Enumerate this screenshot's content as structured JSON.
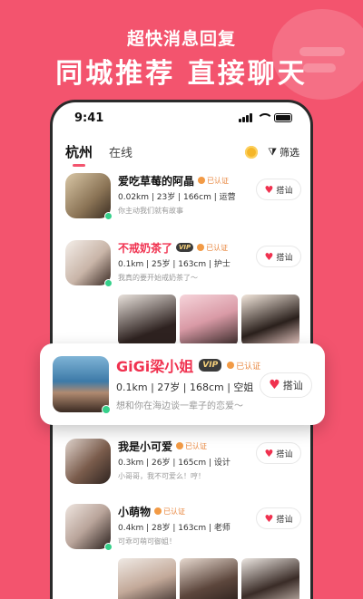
{
  "hero": {
    "subtitle": "超快消息回复",
    "title": "同城推荐 直接聊天"
  },
  "status_bar": {
    "time": "9:41"
  },
  "tabs": [
    {
      "label": "杭州",
      "active": true
    },
    {
      "label": "在线",
      "active": false
    }
  ],
  "filter": {
    "label": "筛选",
    "icon": "filter-icon"
  },
  "colors": {
    "brand": "#f3546e",
    "name_red": "#f0314f",
    "online": "#35d08a",
    "verified": "#e8853c"
  },
  "verified_label": "已认证",
  "vip_label": "VIP",
  "chat_label": "搭讪",
  "users": [
    {
      "name": "爱吃草莓的阿晶",
      "vip": false,
      "meta": "0.02km | 23岁 | 166cm | 运营",
      "bio": "你主动我们就有故事"
    },
    {
      "name": "不戒奶茶了",
      "vip": true,
      "meta": "0.1km | 25岁 | 163cm | 护士",
      "bio": "我真的要开始戒奶茶了～"
    },
    {
      "name": "我是小可爱",
      "vip": false,
      "meta": "0.3km | 26岁 | 165cm | 设计",
      "bio": "小哥哥，我不可爱么！哼！"
    },
    {
      "name": "小萌物",
      "vip": false,
      "meta": "0.4km | 28岁 | 163cm | 老师",
      "bio": "可乖可萌可御姐！"
    }
  ],
  "popup_user": {
    "name": "GiGi梁小姐",
    "vip": true,
    "meta": "0.1km | 27岁 | 168cm | 空姐",
    "bio": "想和你在海边谈一辈子的恋爱～"
  }
}
